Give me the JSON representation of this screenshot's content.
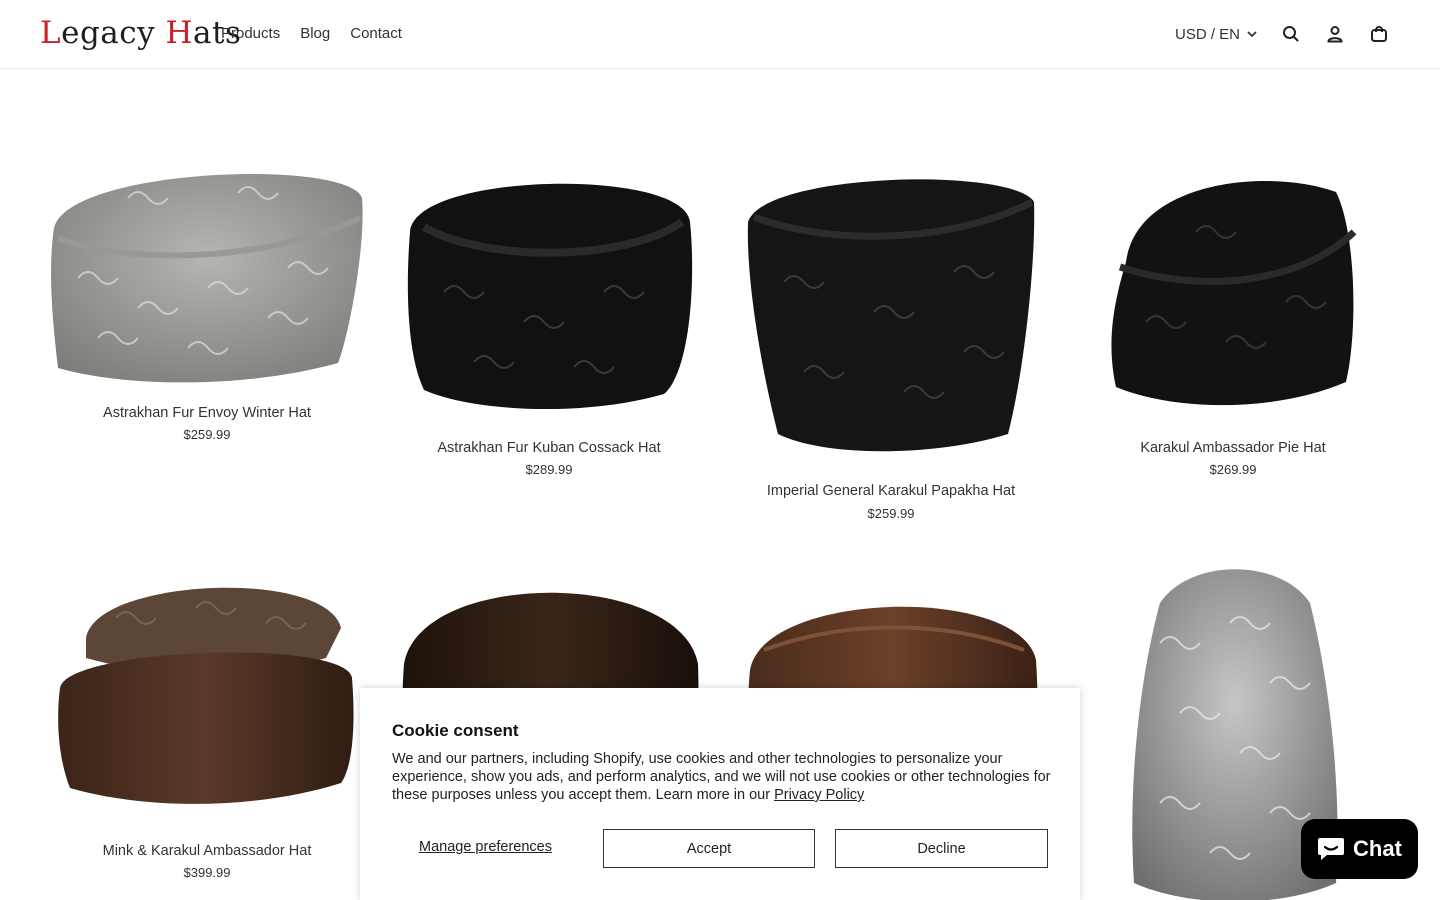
{
  "brand": {
    "logo_text_a": "L",
    "logo_text_b": "egacy ",
    "logo_text_c": "H",
    "logo_text_d": "ats",
    "accent": "#c8202b"
  },
  "nav": {
    "items": [
      {
        "label": "Products"
      },
      {
        "label": "Blog"
      },
      {
        "label": "Contact"
      }
    ]
  },
  "header_right": {
    "currency": "USD / EN",
    "icons": [
      "chevron-down-icon",
      "search-icon",
      "account-icon",
      "cart-icon"
    ]
  },
  "products": [
    {
      "name": "Astrakhan Fur Envoy Winter Hat",
      "price": "$259.99",
      "fur": "grey-curly"
    },
    {
      "name": "Astrakhan Fur Kuban Cossack Hat",
      "price": "$289.99",
      "fur": "black-curly"
    },
    {
      "name": "Imperial General Karakul Papakha Hat",
      "price": "$259.99",
      "fur": "black-curly"
    },
    {
      "name": "Karakul Ambassador Pie Hat",
      "price": "$269.99",
      "fur": "black-curly"
    },
    {
      "name": "Mink & Karakul Ambassador Hat",
      "price": "$399.99",
      "fur": "brown-mink"
    },
    {
      "name": "",
      "price": "",
      "fur": "dark-mink"
    },
    {
      "name": "",
      "price": "",
      "fur": "brown-mink"
    },
    {
      "name": "",
      "price": "",
      "fur": "grey-curly"
    }
  ],
  "cookie": {
    "title": "Cookie consent",
    "body": "We and our partners, including Shopify, use cookies and other technologies to personalize your experience, show you ads, and perform analytics, and we will not use cookies or other technologies for these purposes unless you accept them. Learn more in our ",
    "link": "Privacy Policy",
    "manage": "Manage preferences",
    "accept": "Accept",
    "decline": "Decline"
  },
  "chat": {
    "label": "Chat"
  }
}
